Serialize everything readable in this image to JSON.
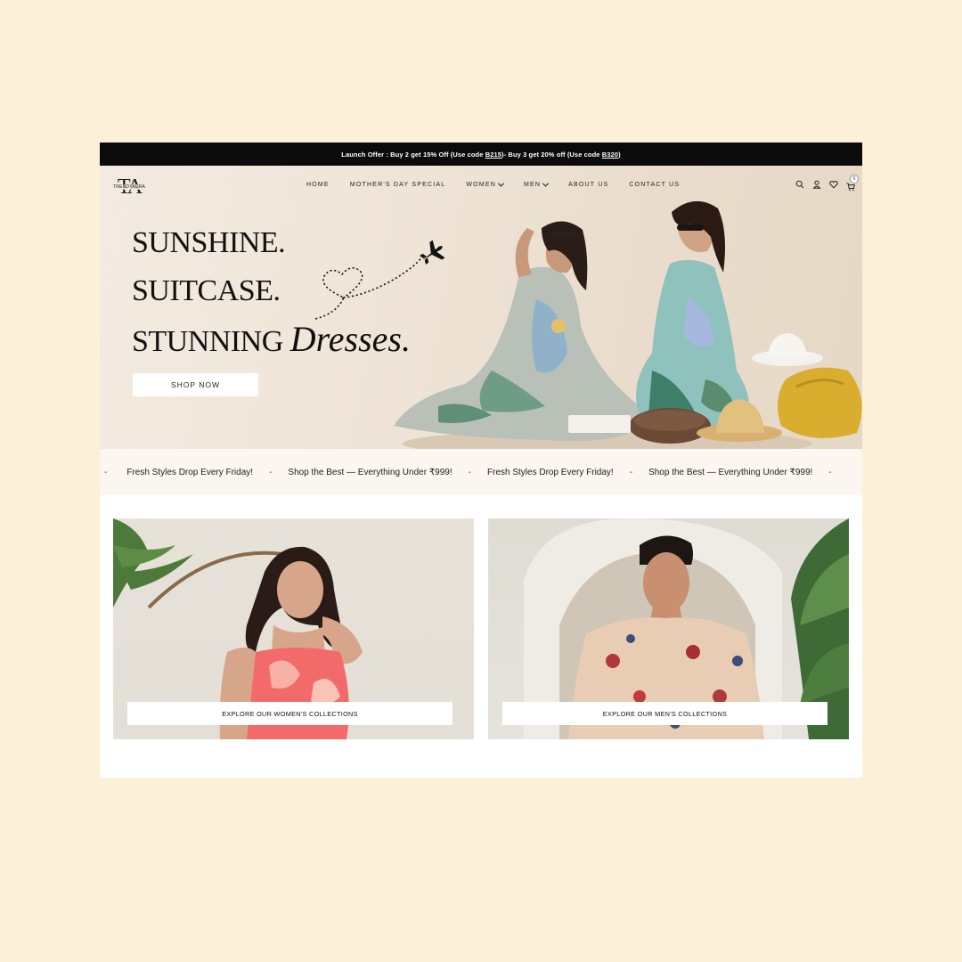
{
  "promo": {
    "label": "Launch Offer",
    "part1": " : Buy 2 get 15% Off (Use code ",
    "code1": "B215",
    "part2": ")- Buy 3 get 20% off (Use code ",
    "code2": "B320",
    "part3": ")"
  },
  "brand": {
    "monogram": "TA",
    "name": "TRENDYAURA"
  },
  "nav": {
    "home": "HOME",
    "mothers_day": "MOTHER'S DAY SPECIAL",
    "women": "WOMEN",
    "men": "MEN",
    "about": "ABOUT US",
    "contact": "CONTACT US"
  },
  "header_icons": [
    "search-icon",
    "account-icon",
    "heart-icon",
    "cart-icon"
  ],
  "cart_count": "0",
  "hero": {
    "line1": "SUNSHINE.",
    "line2": "SUITCASE.",
    "line3": "STUNNING",
    "script_word": "Dresses.",
    "cta": "SHOP NOW",
    "slides": 6,
    "active_slide": 2
  },
  "ticker": {
    "sep": "-",
    "items": [
      "Fresh Styles Drop Every Friday!",
      "Shop the Best — Everything Under ₹999!",
      "Fresh Styles Drop Every Friday!",
      "Shop the Best — Everything Under ₹999!"
    ]
  },
  "collections": {
    "women_cta": "EXPLORE OUR WOMEN'S COLLECTIONS",
    "men_cta": "EXPLORE OUR MEN'S COLLECTIONS"
  },
  "colors": {
    "page_bg": "#fdf0d8",
    "promo_bg": "#0b0b0b",
    "hero_bg": "#efe4d7",
    "text": "#111111"
  }
}
